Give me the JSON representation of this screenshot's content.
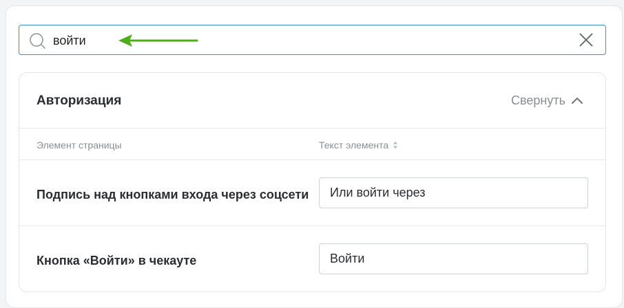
{
  "search": {
    "value": "войти"
  },
  "section": {
    "title": "Авторизация",
    "collapse_label": "Свернуть"
  },
  "table": {
    "columns": {
      "element": "Элемент страницы",
      "text": "Текст элемента"
    },
    "rows": [
      {
        "label": "Подпись над кнопками входа через соцсети",
        "value": "Или войти через"
      },
      {
        "label": "Кнопка «Войти» в чекауте",
        "value": "Войти"
      }
    ]
  },
  "colors": {
    "arrow": "#4caf1a",
    "search_border": "#3f8fc4",
    "muted_text": "#8a8d93",
    "body_text": "#2b2d31"
  },
  "icons": {
    "search": "search-icon",
    "clear": "close-icon",
    "collapse": "chevron-up-icon",
    "sort": "sort-icon",
    "annotation": "arrow-left-icon"
  }
}
